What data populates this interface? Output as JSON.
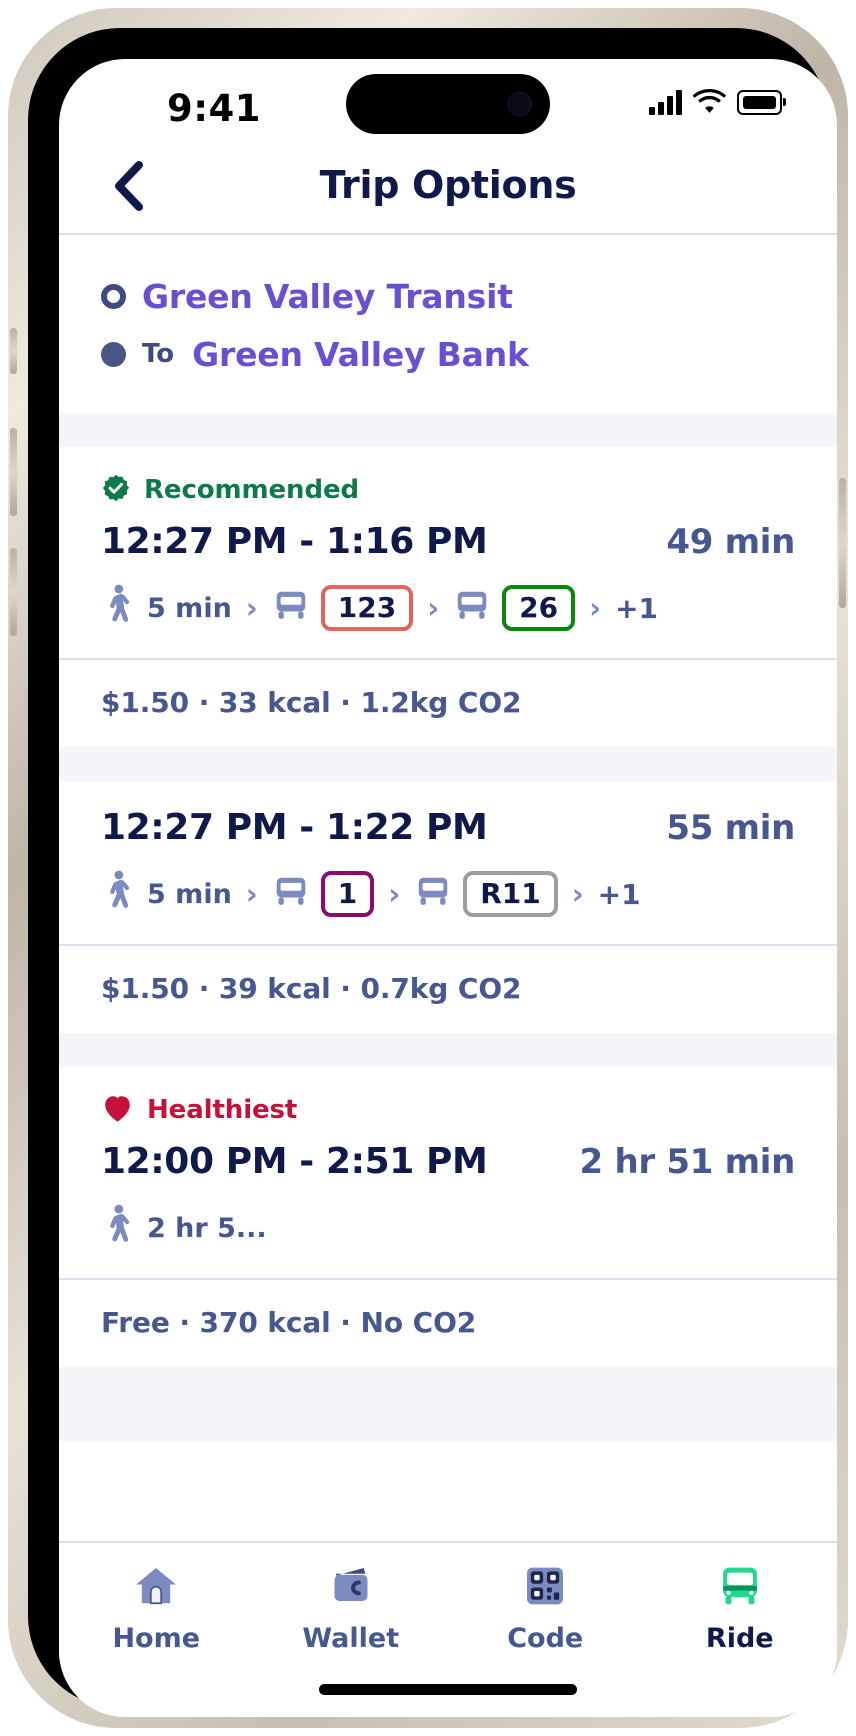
{
  "status_bar": {
    "time": "9:41",
    "signal_icon": "cellular-bars-icon",
    "wifi_icon": "wifi-icon",
    "battery_icon": "battery-full-icon"
  },
  "nav": {
    "back_icon": "chevron-left-icon",
    "title": "Trip Options"
  },
  "trip": {
    "origin": {
      "marker": "circle-outline-icon",
      "name": "Green Valley Transit"
    },
    "destination": {
      "marker": "circle-filled-icon",
      "prefix": "To",
      "name": "Green Valley Bank"
    }
  },
  "options": [
    {
      "badge": {
        "icon": "verified-badge-icon",
        "label": "Recommended",
        "color": "#0e7a4a"
      },
      "time_range": "12:27 PM - 1:16 PM",
      "duration": "49 min",
      "legs": [
        {
          "type": "walk",
          "icon": "walking-person-icon",
          "text": "5 min"
        },
        {
          "type": "chevron",
          "icon": "chevron-right-icon",
          "text": ">"
        },
        {
          "type": "bus",
          "icon": "bus-icon",
          "route": "123",
          "route_color": "#e2645f"
        },
        {
          "type": "chevron",
          "icon": "chevron-right-icon",
          "text": ">"
        },
        {
          "type": "bus",
          "icon": "bus-icon",
          "route": "26",
          "route_color": "#08890b"
        },
        {
          "type": "chevron",
          "icon": "chevron-right-icon",
          "text": ">"
        },
        {
          "type": "more",
          "text": "+1"
        }
      ],
      "details": "$1.50 · 33 kcal · 1.2kg CO2"
    },
    {
      "badge": null,
      "time_range": "12:27 PM - 1:22 PM",
      "duration": "55 min",
      "legs": [
        {
          "type": "walk",
          "icon": "walking-person-icon",
          "text": "5 min"
        },
        {
          "type": "chevron",
          "icon": "chevron-right-icon",
          "text": ">"
        },
        {
          "type": "bus",
          "icon": "bus-icon",
          "route": "1",
          "route_color": "#8a0b72"
        },
        {
          "type": "chevron",
          "icon": "chevron-right-icon",
          "text": ">"
        },
        {
          "type": "bus",
          "icon": "bus-icon",
          "route": "R11",
          "route_color": "#9e9e9e"
        },
        {
          "type": "chevron",
          "icon": "chevron-right-icon",
          "text": ">"
        },
        {
          "type": "more",
          "text": "+1"
        }
      ],
      "details": "$1.50 · 39 kcal · 0.7kg CO2"
    },
    {
      "badge": {
        "icon": "heart-icon",
        "label": "Healthiest",
        "color": "#c5103a"
      },
      "time_range": "12:00 PM - 2:51 PM",
      "duration": "2 hr 51 min",
      "legs": [
        {
          "type": "walk",
          "icon": "walking-person-icon",
          "text": "2 hr 5..."
        }
      ],
      "details": "Free · 370 kcal · No CO2"
    }
  ],
  "tabs": [
    {
      "label": "Home",
      "icon": "home-icon",
      "active": false
    },
    {
      "label": "Wallet",
      "icon": "wallet-icon",
      "active": false
    },
    {
      "label": "Code",
      "icon": "qr-code-icon",
      "active": false
    },
    {
      "label": "Ride",
      "icon": "bus-icon",
      "active": true
    }
  ],
  "colors": {
    "primary_text": "#101a4a",
    "secondary_text": "#47578f",
    "link_purple": "#6a4fd0",
    "band": "#f4f4f9",
    "divider": "#d9dff0",
    "ride_green": "#21d98a"
  }
}
